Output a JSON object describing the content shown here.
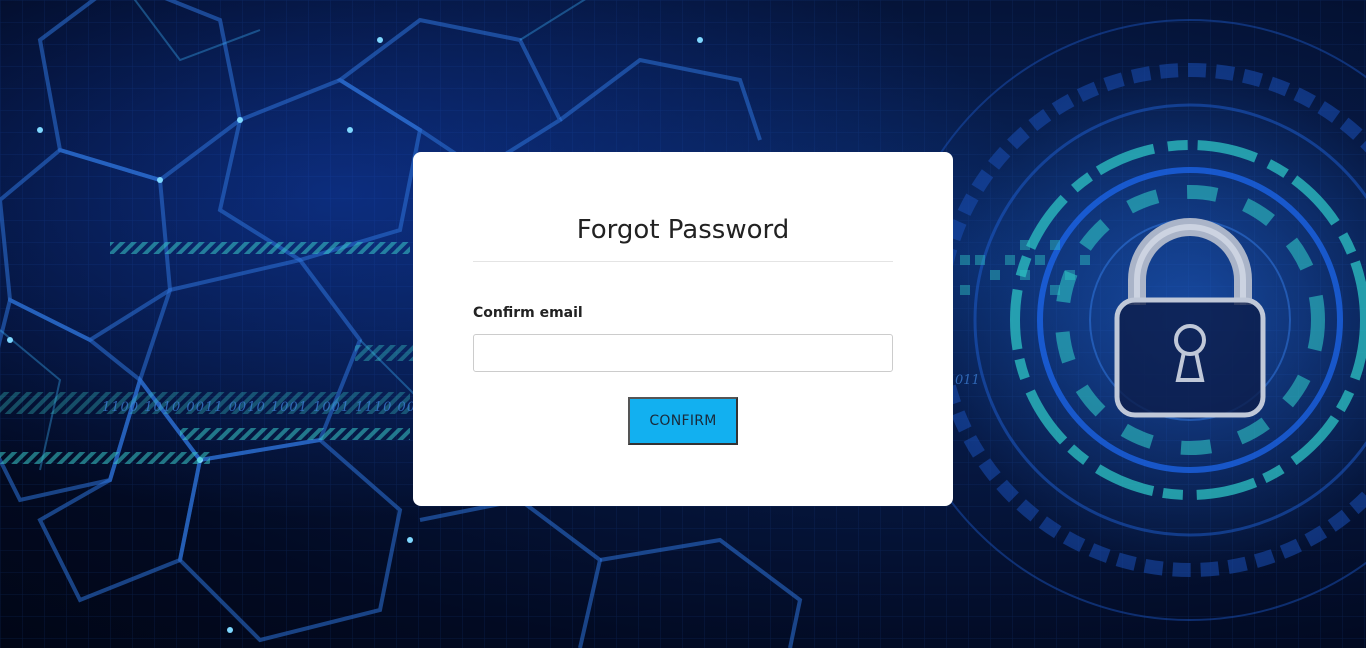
{
  "form": {
    "title": "Forgot Password",
    "email_label": "Confirm email",
    "email_value": "",
    "email_placeholder": "",
    "confirm_label": "CONFIRM"
  },
  "background": {
    "binary_text": "1100 1010 0011 0010 1001 1001 1110 00",
    "binary_text_right": "011",
    "lock_icon": "padlock-icon",
    "colors": {
      "base": "#020a22",
      "glow": "#0a2a66",
      "accent_teal": "#2ec4c4",
      "accent_blue": "#1e6fff"
    }
  },
  "colors": {
    "card": "#ffffff",
    "button": "#12b0f0",
    "title": "#222222"
  }
}
